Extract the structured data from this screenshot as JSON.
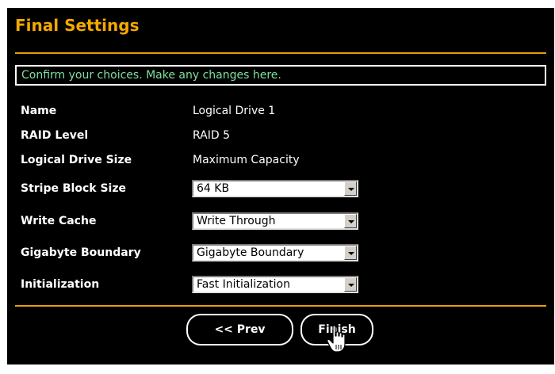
{
  "title": "Final Settings",
  "info": "Confirm your choices. Make any changes here.",
  "fields": {
    "name": {
      "label": "Name",
      "value": "Logical Drive 1"
    },
    "raid_level": {
      "label": "RAID Level",
      "value": "RAID 5"
    },
    "logical_drive_size": {
      "label": "Logical Drive Size",
      "value": "Maximum Capacity"
    },
    "stripe_block_size": {
      "label": "Stripe Block Size",
      "value": "64 KB"
    },
    "write_cache": {
      "label": "Write Cache",
      "value": "Write Through"
    },
    "gigabyte_boundary": {
      "label": "Gigabyte Boundary",
      "value": "Gigabyte Boundary"
    },
    "initialization": {
      "label": "Initialization",
      "value": "Fast Initialization"
    }
  },
  "buttons": {
    "prev": "<< Prev",
    "finish": "Finish"
  },
  "colors": {
    "accent": "#f4a800",
    "info_text": "#7fe0a0",
    "background": "#000000"
  },
  "icons": {
    "cursor": "hand-pointer-icon",
    "dropdown": "chevron-down-icon"
  }
}
